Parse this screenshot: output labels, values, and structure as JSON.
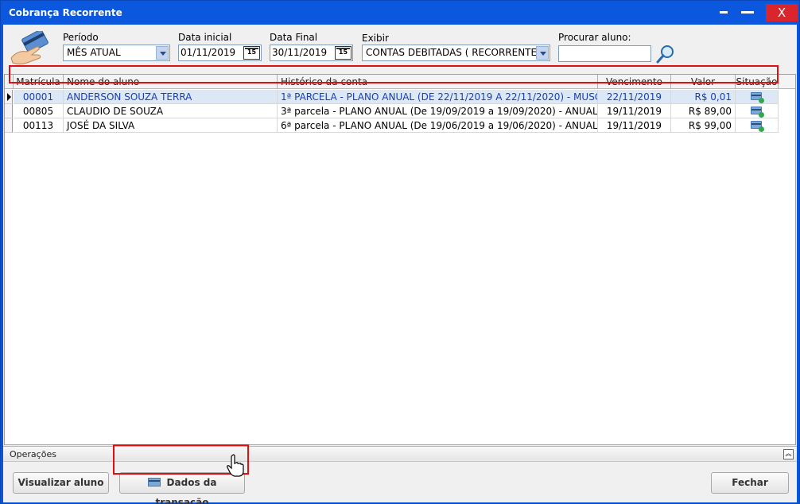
{
  "window": {
    "title": "Cobrança Recorrente",
    "close_label": "X"
  },
  "filters": {
    "periodo_label": "Período",
    "periodo_value": "MÊS ATUAL",
    "data_inicial_label": "Data inicial",
    "data_inicial_value": "01/11/2019",
    "data_final_label": "Data Final",
    "data_final_value": "30/11/2019",
    "exibir_label": "Exibir",
    "exibir_value": "CONTAS DEBITADAS ( RECORRENTE )",
    "procurar_label": "Procurar aluno:",
    "calendar_day": "15"
  },
  "grid": {
    "columns": [
      "Matrícula",
      "Nome do aluno",
      "Histórico da conta",
      "Vencimento",
      "Valor",
      "Situação"
    ],
    "rows": [
      {
        "matricula": "00001",
        "nome": "ANDERSON SOUZA TERRA",
        "historico": "1ª PARCELA - PLANO ANUAL (DE 22/11/2019 A 22/11/2020) - MUSCULAÇÃO",
        "vencimento": "22/11/2019",
        "valor": "R$ 0,01",
        "situacao_icon": "card-check-icon",
        "selected": true
      },
      {
        "matricula": "00805",
        "nome": "CLAUDIO DE SOUZA",
        "historico": "3ª parcela - PLANO ANUAL (De 19/09/2019 a 19/09/2020) - ANUAL FAMÍLIA",
        "vencimento": "19/11/2019",
        "valor": "R$ 89,00",
        "situacao_icon": "card-check-icon",
        "selected": false
      },
      {
        "matricula": "00113",
        "nome": "JOSÉ DA SILVA",
        "historico": "6ª parcela - PLANO ANUAL (De 19/06/2019 a 19/06/2020) - ANUAL  RECORRENTE",
        "vencimento": "19/11/2019",
        "valor": "R$ 99,00",
        "situacao_icon": "card-check-icon",
        "selected": false
      }
    ]
  },
  "operations": {
    "label": "Operações",
    "visualizar_label": "Visualizar aluno",
    "dados_label": "Dados da transação",
    "fechar_label": "Fechar"
  },
  "colors": {
    "titlebar": "#0b58de",
    "highlight": "#e01010",
    "selected_text": "#1a3fb0",
    "close": "#d9252b"
  }
}
